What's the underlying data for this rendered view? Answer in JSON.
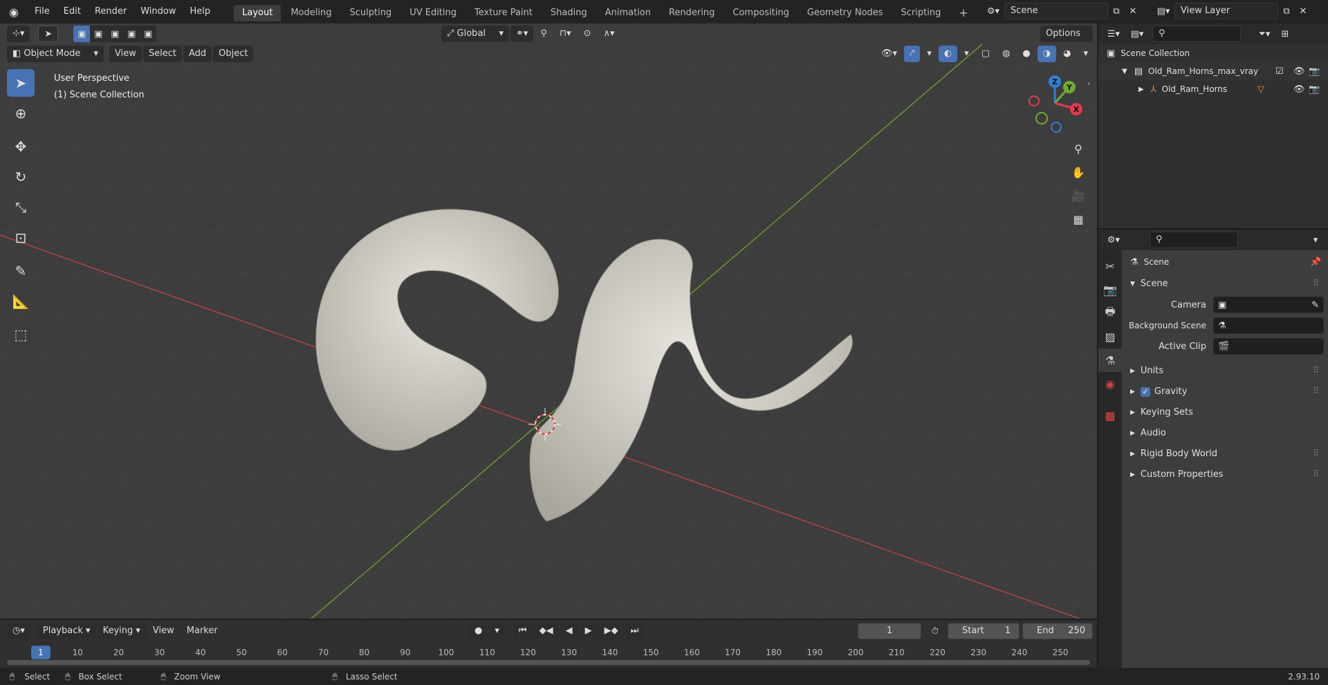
{
  "topbar": {
    "menus": [
      "File",
      "Edit",
      "Render",
      "Window",
      "Help"
    ],
    "workspaces": [
      "Layout",
      "Modeling",
      "Sculpting",
      "UV Editing",
      "Texture Paint",
      "Shading",
      "Animation",
      "Rendering",
      "Compositing",
      "Geometry Nodes",
      "Scripting"
    ],
    "active_workspace": "Layout",
    "scene": "Scene",
    "view_layer": "View Layer"
  },
  "viewport": {
    "mode": "Object Mode",
    "menus": [
      "View",
      "Select",
      "Add",
      "Object"
    ],
    "transform_orientation": "Global",
    "options_label": "Options",
    "overlay_text_1": "User Perspective",
    "overlay_text_2": "(1) Scene Collection",
    "gizmo_labels": {
      "z": "Z",
      "y": "Y",
      "x": "X"
    }
  },
  "outliner": {
    "root": "Scene Collection",
    "collection": "Old_Ram_Horns_max_vray",
    "object": "Old_Ram_Horns"
  },
  "properties": {
    "header": "Scene",
    "panel_title": "Scene",
    "fields": [
      {
        "label": "Camera"
      },
      {
        "label": "Background Scene"
      },
      {
        "label": "Active Clip"
      }
    ],
    "sections": [
      "Units",
      "Gravity",
      "Keying Sets",
      "Audio",
      "Rigid Body World",
      "Custom Properties"
    ],
    "gravity_checked": true
  },
  "timeline": {
    "menus": [
      "Playback",
      "Keying",
      "View",
      "Marker"
    ],
    "current_frame": "1",
    "start_label": "Start",
    "start": "1",
    "end_label": "End",
    "end": "250",
    "ticks": [
      "1",
      "10",
      "20",
      "30",
      "40",
      "50",
      "60",
      "70",
      "80",
      "90",
      "100",
      "110",
      "120",
      "130",
      "140",
      "150",
      "160",
      "170",
      "180",
      "190",
      "200",
      "210",
      "220",
      "230",
      "240",
      "250"
    ]
  },
  "statusbar": {
    "select": "Select",
    "box_select": "Box Select",
    "zoom_view": "Zoom View",
    "lasso_select": "Lasso Select",
    "version": "2.93.10"
  },
  "colors": {
    "accent": "#4772b3",
    "x_axis": "#b34247",
    "y_axis": "#6b9a2c",
    "gizmo_z": "#2f7fd8",
    "gizmo_y": "#6eac32",
    "gizmo_x": "#e03c4c",
    "horn": "#d8d6ce"
  }
}
